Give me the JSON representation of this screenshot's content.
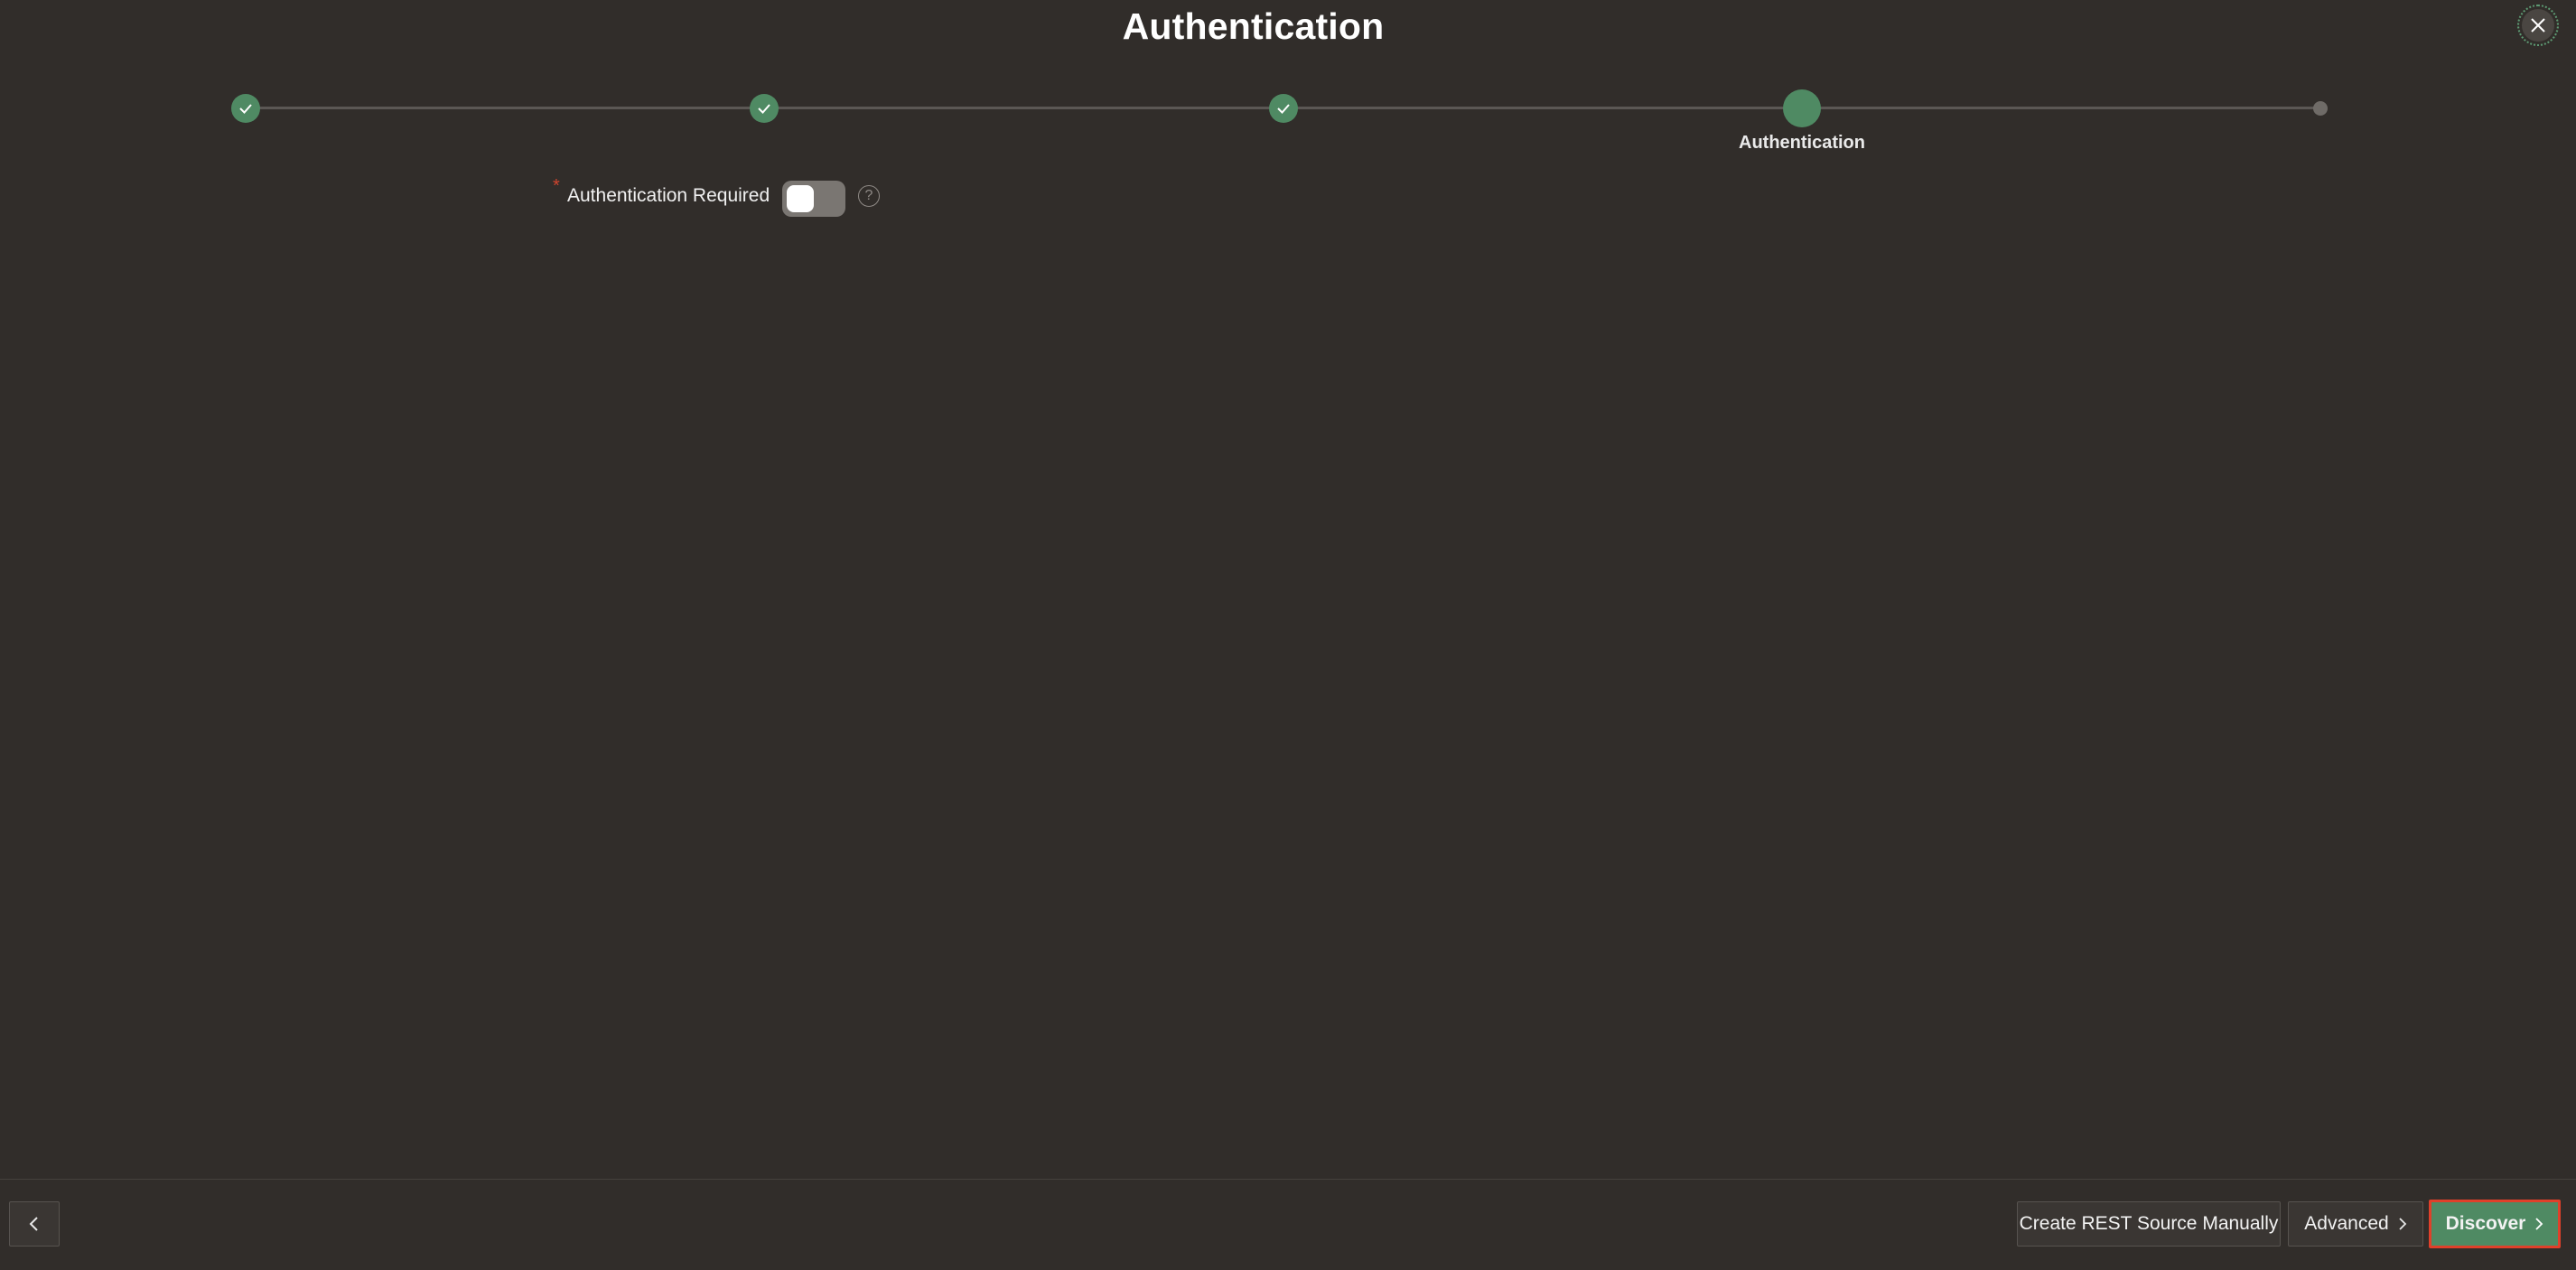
{
  "dialog": {
    "title": "Authentication",
    "close_label": "Close"
  },
  "train": {
    "steps": [
      {
        "status": "complete",
        "label": ""
      },
      {
        "status": "complete",
        "label": ""
      },
      {
        "status": "complete",
        "label": ""
      },
      {
        "status": "current",
        "label": "Authentication"
      },
      {
        "status": "future",
        "label": ""
      }
    ]
  },
  "form": {
    "auth_required": {
      "label": "Authentication Required",
      "required_marker": "*",
      "value": false,
      "help_glyph": "?"
    }
  },
  "footer": {
    "back_label": "",
    "create_manual_label": "Create REST Source Manually",
    "advanced_label": "Advanced",
    "discover_label": "Discover"
  },
  "colors": {
    "background": "#312d2a",
    "accent_green": "#4f8a63",
    "highlight_red": "#e0402a"
  },
  "icons": {
    "close": "close-icon",
    "check": "check-icon",
    "help": "help-icon",
    "back": "chevron-left-icon",
    "next": "chevron-right-icon"
  }
}
